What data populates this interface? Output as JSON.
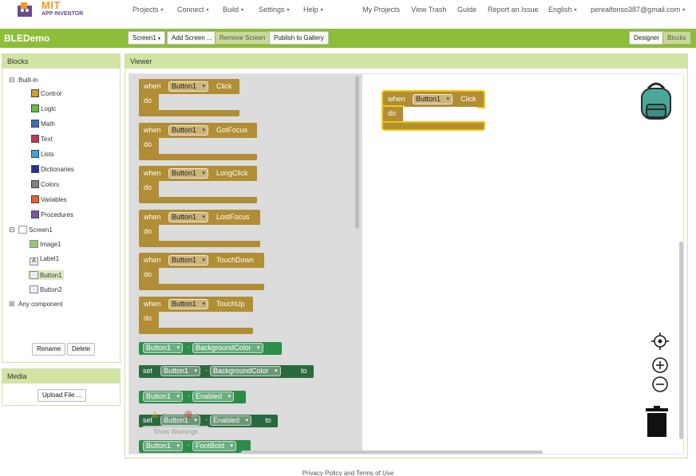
{
  "app": {
    "logo_line1": "MIT",
    "logo_line2": "APP INVENTOR"
  },
  "nav": {
    "left": [
      "Projects",
      "Connect",
      "Build",
      "Settings",
      "Help"
    ],
    "right": [
      "My Projects",
      "View Trash",
      "Guide",
      "Report an Issue",
      "English",
      "perealfonso387@gmail.com"
    ]
  },
  "project": {
    "title": "BLEDemo",
    "screen_select": "Screen1",
    "add_screen": "Add Screen ...",
    "remove_screen": "Remove Screen",
    "publish": "Publish to Gallery",
    "designer": "Designer",
    "blocks": "Blocks"
  },
  "blocks_panel": {
    "title": "Blocks",
    "builtin_label": "Built-in",
    "builtin": [
      {
        "label": "Control",
        "color": "#c8a032"
      },
      {
        "label": "Logic",
        "color": "#6abf3c"
      },
      {
        "label": "Math",
        "color": "#3b6fb5"
      },
      {
        "label": "Text",
        "color": "#c8325a"
      },
      {
        "label": "Lists",
        "color": "#40a3d8"
      },
      {
        "label": "Dictionaries",
        "color": "#2d2d9a"
      },
      {
        "label": "Colors",
        "color": "#808080"
      },
      {
        "label": "Variables",
        "color": "#e5632c"
      },
      {
        "label": "Procedures",
        "color": "#7d56a0"
      }
    ],
    "screen_label": "Screen1",
    "components": [
      {
        "label": "Image1",
        "icon": "image-icon"
      },
      {
        "label": "Label1",
        "icon": "label-icon"
      },
      {
        "label": "Button1",
        "icon": "button-icon"
      },
      {
        "label": "Button2",
        "icon": "button-icon"
      }
    ],
    "any_component": "Any component",
    "rename": "Rename",
    "delete": "Delete"
  },
  "media_panel": {
    "title": "Media",
    "upload": "Upload File ..."
  },
  "viewer": {
    "title": "Viewer",
    "when": "when",
    "do": "do",
    "set": "set",
    "to": "to",
    "component": "Button1",
    "events": [
      "Click",
      "GotFocus",
      "LongClick",
      "LostFocus",
      "TouchDown",
      "TouchUp"
    ],
    "properties": [
      {
        "kind": "get",
        "prop": "BackgroundColor"
      },
      {
        "kind": "set",
        "prop": "BackgroundColor"
      },
      {
        "kind": "get",
        "prop": "Enabled"
      },
      {
        "kind": "set",
        "prop": "Enabled"
      },
      {
        "kind": "get",
        "prop": "FontBold"
      }
    ],
    "workspace_block_event": "Click",
    "warnings": {
      "count_a": "0",
      "count_b": "0",
      "show": "Show Warnings"
    }
  },
  "footer": "Privacy Policy and Terms of Use"
}
